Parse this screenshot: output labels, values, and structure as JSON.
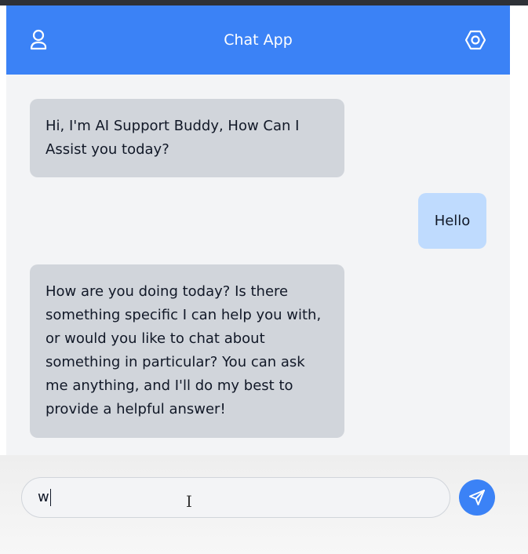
{
  "header": {
    "title": "Chat App",
    "user_icon": "user-icon",
    "settings_icon": "settings-icon",
    "color": "#3b82f6"
  },
  "messages": [
    {
      "sender": "ai",
      "text": "Hi, I'm AI Support Buddy, How Can I Assist you today?"
    },
    {
      "sender": "user",
      "text": "Hello"
    },
    {
      "sender": "ai",
      "text": "How are you doing today? Is there something specific I can help you with, or would you like to chat about something in particular? You can ask me anything, and I'll do my best to provide a helpful answer!"
    }
  ],
  "composer": {
    "value": "w",
    "send_icon": "send-icon"
  },
  "colors": {
    "ai_bubble": "#d1d5db",
    "user_bubble": "#bfdbfe",
    "accent": "#3b82f6"
  }
}
